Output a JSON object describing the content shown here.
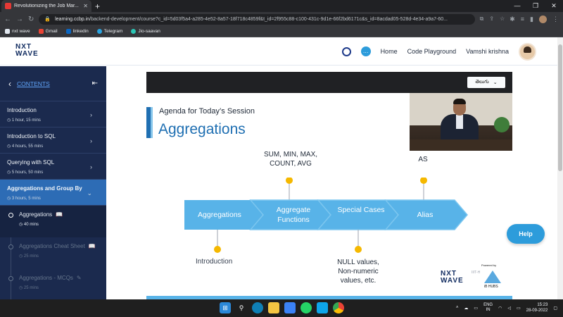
{
  "browser": {
    "tab_title": "Revolutionizing the Job Mar...",
    "tab_close": "✕",
    "new_tab": "+",
    "url_host": "learning.ccbp.in",
    "url_path": "/backend-development/course?c_id=5d03f5a4-a285-4e52-8a57-18f718c4859f&t_id=2f955c88-c100-431c-9d1e-66f2bd6171c&s_id=8acdad05-528d-4e34-a9a7-60...",
    "bookmarks": [
      {
        "label": "nxt wave",
        "color": "#e2e8f0"
      },
      {
        "label": "Gmail",
        "color": "#ea4335"
      },
      {
        "label": "linkedin",
        "color": "#0a66c2"
      },
      {
        "label": "Telegram",
        "color": "#2aa3df"
      },
      {
        "label": "Jio-saavan",
        "color": "#2bc5b4"
      }
    ]
  },
  "header": {
    "logo_line1": "NXT",
    "logo_line2": "WAVE",
    "nav_home": "Home",
    "nav_code_playground": "Code Playground",
    "user_name": "Vamshi krishna"
  },
  "sidebar": {
    "title": "CONTENTS",
    "chapters": [
      {
        "title": "Introduction",
        "duration": "1 hour, 15 mins"
      },
      {
        "title": "Introduction to SQL",
        "duration": "4 hours, 55 mins"
      },
      {
        "title": "Querying with SQL",
        "duration": "5 hours, 50 mins"
      },
      {
        "title": "Aggregations and Group By",
        "duration": "3 hours, 5 mins"
      }
    ],
    "units": [
      {
        "title": "Aggregations",
        "duration": "40 mins"
      },
      {
        "title": "Aggregations Cheat Sheet",
        "duration": "25 mins"
      },
      {
        "title": "Aggregations - MCQs",
        "duration": "25 mins"
      }
    ]
  },
  "video": {
    "language": "తెలుగు",
    "agenda": "Agenda for Today’s Session",
    "title": "Aggregations",
    "stages": [
      "Aggregations",
      "Aggregate Functions",
      "Special Cases",
      "Alias"
    ],
    "top_label_functions": "SUM, MIN, MAX, COUNT, AVG",
    "top_label_alias": "AS",
    "bottom_label_intro": "Introduction",
    "bottom_label_special": "NULL values, Non-numeric values, etc.",
    "brand_logo": "NXT WAVE",
    "powered_by": "Powered by",
    "iiit": "IIIT-H",
    "ib_hubs": "iB HUBS"
  },
  "help_button": "Help",
  "taskbar": {
    "lang_line1": "ENG",
    "lang_line2": "IN",
    "time": "15:23",
    "date": "28-09-2022"
  },
  "colors": {
    "sidebar_bg": "#1b2a4e",
    "active_chapter": "#2d6cb5",
    "slide_blue": "#58b3e8",
    "accent_blue": "#1f6fb2",
    "marker_yellow": "#f5b800"
  }
}
